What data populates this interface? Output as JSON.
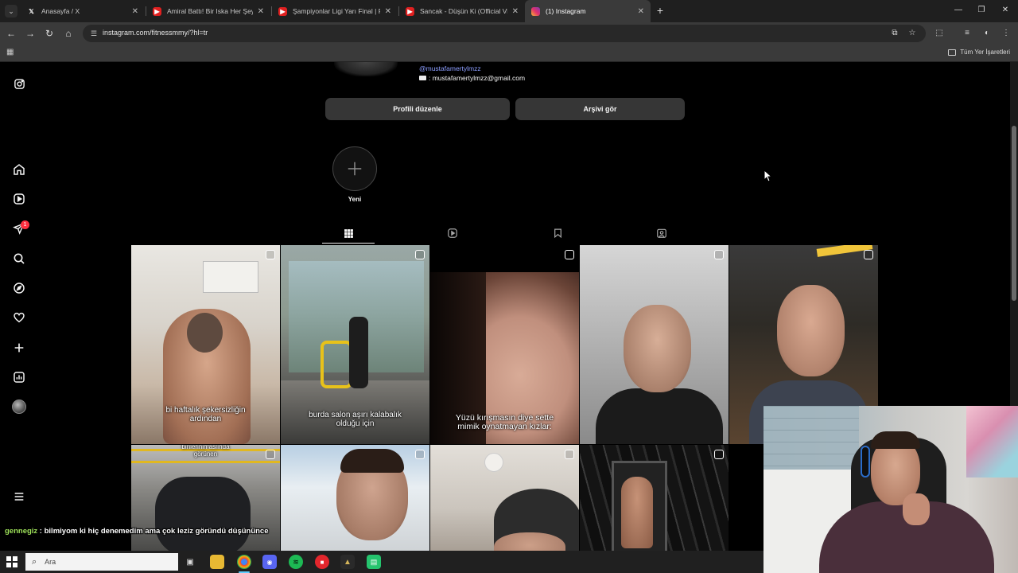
{
  "browser": {
    "tabs": [
      {
        "title": "Anasayfa / X",
        "icon": "x-logo"
      },
      {
        "title": "Amiral Battı! Bir Iska Her Şeyi B",
        "icon": "youtube-logo"
      },
      {
        "title": "Şampiyonlar Ligi Yarı Final | PSG",
        "icon": "youtube-logo"
      },
      {
        "title": "Sancak - Düşün Ki (Official Vide",
        "icon": "youtube-logo"
      },
      {
        "title": "(1) Instagram",
        "icon": "instagram-logo",
        "active": true
      }
    ],
    "url": "instagram.com/fitnessmmy/?hl=tr",
    "bookmarks_all": "Tüm Yer İşaretleri"
  },
  "profile": {
    "handle": "@mustafamertylmzz",
    "email": ": mustafamertylmzz@gmail.com",
    "edit_button": "Profili düzenle",
    "archive_button": "Arşivi gör",
    "highlight_new_label": "Yeni"
  },
  "sidebar": {
    "notification_count": "1",
    "items": [
      "home-icon",
      "reels-icon",
      "messages-icon",
      "search-icon",
      "explore-icon",
      "heart-icon",
      "create-icon",
      "dashboard-icon",
      "profile-avatar",
      "menu-icon"
    ]
  },
  "posts": [
    {
      "caption": "bi haftalık şekersizliğin\nardından"
    },
    {
      "caption": "burda salon aşırı kalabalık\nolduğu için"
    },
    {
      "caption": "Yüzü kırışmasın diye sette\nmimik oynatmayan kızlar:"
    },
    {
      "caption": ""
    },
    {
      "caption": ""
    },
    {
      "caption": "birilerinin aslında\ngörünen"
    },
    {
      "caption": ""
    },
    {
      "caption": ""
    },
    {
      "caption": ""
    }
  ],
  "chat": {
    "user": "gennegiz",
    "message": " : bilmiyom ki hiç denemedim ama çok leziz göründü düşününce"
  },
  "taskbar": {
    "search_placeholder": "Ara"
  },
  "colors": {
    "background": "#000000",
    "button": "#363636",
    "link": "#8c9eff",
    "notification": "#ff3040"
  }
}
